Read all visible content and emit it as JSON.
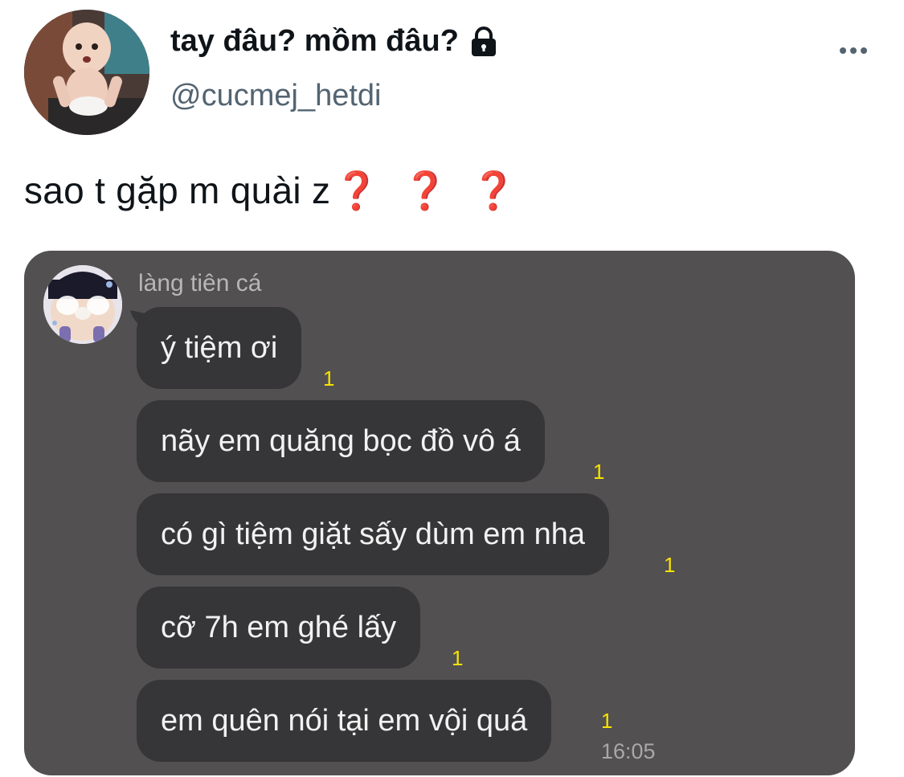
{
  "tweet": {
    "author": {
      "display_name": "tay đâu? mồm đâu?",
      "handle": "@cucmej_hetdi"
    },
    "text": "sao t gặp m quài z",
    "emoji_question_marks": "❓❓❓"
  },
  "chat": {
    "sender_name": "làng tiên cá",
    "messages": [
      {
        "text": "ý tiệm ơi",
        "unread": "1"
      },
      {
        "text": "nãy em quăng bọc đồ vô á",
        "unread": "1"
      },
      {
        "text": "có gì tiệm giặt sấy dùm em nha",
        "unread": "1"
      },
      {
        "text": "cỡ 7h em ghé lấy",
        "unread": "1"
      },
      {
        "text": "em quên nói tại em vội quá",
        "unread": "1"
      }
    ],
    "time": "16:05"
  },
  "colors": {
    "handle": "#536471",
    "chat_background": "#525051",
    "bubble": "#363537",
    "unread_count": "#f7e300"
  }
}
